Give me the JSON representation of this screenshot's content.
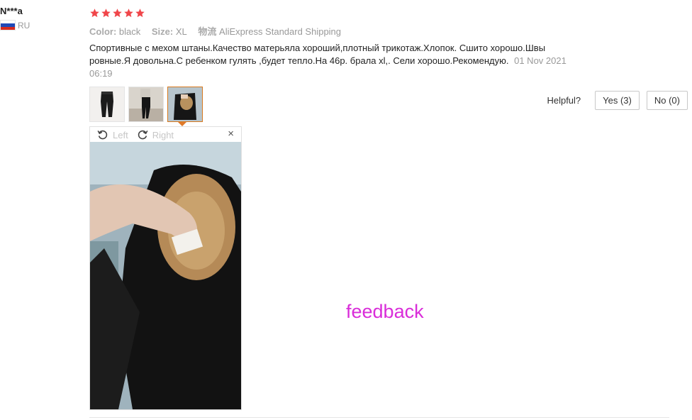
{
  "user": {
    "name": "N***a",
    "country": "RU"
  },
  "rating": {
    "stars": 5,
    "max": 5,
    "color": "#f0464a"
  },
  "meta": {
    "color_key": "Color:",
    "color_value": "black",
    "size_key": "Size:",
    "size_value": "XL",
    "ship_key": "物流",
    "ship_value": "AliExpress Standard Shipping"
  },
  "review": {
    "text": "Спортивные с мехом штаны.Качество матерьяла хороший,плотный трикотаж.Хлопок. Сшито хорошо.Швы ровные.Я довольна.С ребенком гулять ,будет тепло.На 46р. брала xl,. Сели хорошо.Рекомендую.",
    "date": "01 Nov 2021 06:19"
  },
  "thumbnails": [
    {
      "name": "thumb-pants-flat",
      "selected": false
    },
    {
      "name": "thumb-pants-worn",
      "selected": false
    },
    {
      "name": "thumb-pants-fleece",
      "selected": true
    }
  ],
  "helpful": {
    "label": "Helpful?",
    "yes": "Yes (3)",
    "no": "No (0)"
  },
  "viewer": {
    "left_label": "Left",
    "right_label": "Right",
    "close": "×"
  },
  "watermark": {
    "text": "feedback",
    "color": "#d92dd9"
  },
  "icons": {
    "rotate_left": "rotate-left-icon",
    "rotate_right": "rotate-right-icon",
    "close": "close-icon",
    "star": "star-icon",
    "flag": "russia-flag-icon"
  }
}
